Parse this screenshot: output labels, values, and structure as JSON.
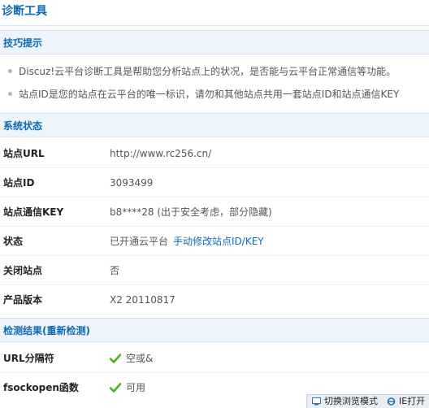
{
  "page_title": "诊断工具",
  "tips": {
    "heading": "技巧提示",
    "items": [
      "Discuz!云平台诊断工具是帮助您分析站点上的状况，是否能与云平台正常通信等功能。",
      "站点ID是您的站点在云平台的唯一标识，请勿和其他站点共用一套站点ID和站点通信KEY"
    ]
  },
  "system_status": {
    "heading": "系统状态",
    "rows": [
      {
        "label": "站点URL",
        "value": "http://www.rc256.cn/"
      },
      {
        "label": "站点ID",
        "value": "3093499"
      },
      {
        "label": "站点通信KEY",
        "value": "b8****28",
        "note": "(出于安全考虑，部分隐藏)"
      },
      {
        "label": "状态",
        "value": "已开通云平台",
        "link": "手动修改站点ID/KEY"
      },
      {
        "label": "关闭站点",
        "value": "否"
      },
      {
        "label": "产品版本",
        "value": "X2 20110817"
      }
    ]
  },
  "results": {
    "heading_prefix": "检测结果(",
    "recheck_label": "重新检测",
    "heading_suffix": ")",
    "rows": [
      {
        "label": "URL分隔符",
        "value": "空或&",
        "icon": "check-icon"
      },
      {
        "label": "fsockopen函数",
        "value": "可用",
        "icon": "check-icon"
      }
    ]
  },
  "statusbar": {
    "browse_mode": "切换浏览模式",
    "ie_label": "IE打开"
  },
  "colors": {
    "accent": "#0f6ab4",
    "section_bg": "#eef4fb",
    "check": "#4caf1f"
  }
}
